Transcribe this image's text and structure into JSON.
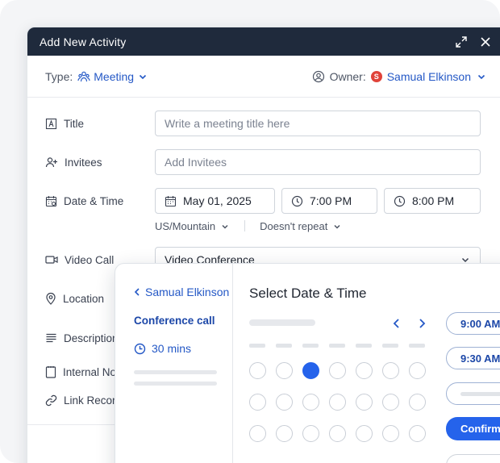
{
  "modal": {
    "title": "Add New Activity",
    "type_label": "Type:",
    "type_value": "Meeting",
    "owner_label": "Owner:",
    "owner_initial": "S",
    "owner_name": "Samual Elkinson"
  },
  "fields": {
    "title": {
      "label": "Title",
      "placeholder": "Write a meeting title here"
    },
    "invitees": {
      "label": "Invitees",
      "placeholder": "Add Invitees"
    },
    "datetime": {
      "label": "Date & Time",
      "date": "May 01, 2025",
      "start": "7:00 PM",
      "end": "8:00 PM"
    },
    "timezone": "US/Mountain",
    "repeat": "Doesn't repeat",
    "video_call": {
      "label": "Video Call",
      "value": "Video Conference"
    },
    "location": {
      "label": "Location"
    },
    "description": {
      "label": "Description"
    },
    "internal_notes": {
      "label": "Internal No"
    },
    "link_records": {
      "label": "Link Recor"
    }
  },
  "scheduler": {
    "back_label": "Samual Elkinson",
    "event_name": "Conference call",
    "duration": "30 mins",
    "title": "Select Date & Time",
    "slots": [
      "9:00 AM",
      "9:30 AM"
    ],
    "confirm_label": "Confirm",
    "selected_day": {
      "row": 1,
      "col": 3
    },
    "accent": "#2563eb"
  },
  "colors": {
    "header_bg": "#1f2a3c",
    "link": "#2458c6",
    "owner_badge": "#e0433a"
  }
}
